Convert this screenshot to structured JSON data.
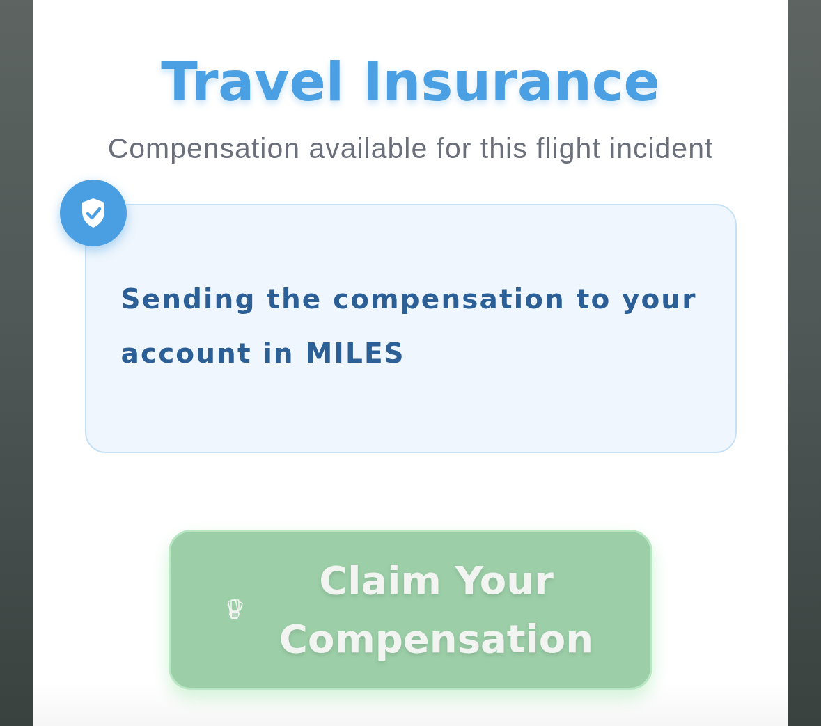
{
  "title": "Travel Insurance",
  "subtitle": "Compensation available for this flight incident",
  "notice": {
    "text": "Sending the compensation to your account in MILES"
  },
  "claim_button": {
    "label": "Claim Your Compensation",
    "disabled": true
  }
}
